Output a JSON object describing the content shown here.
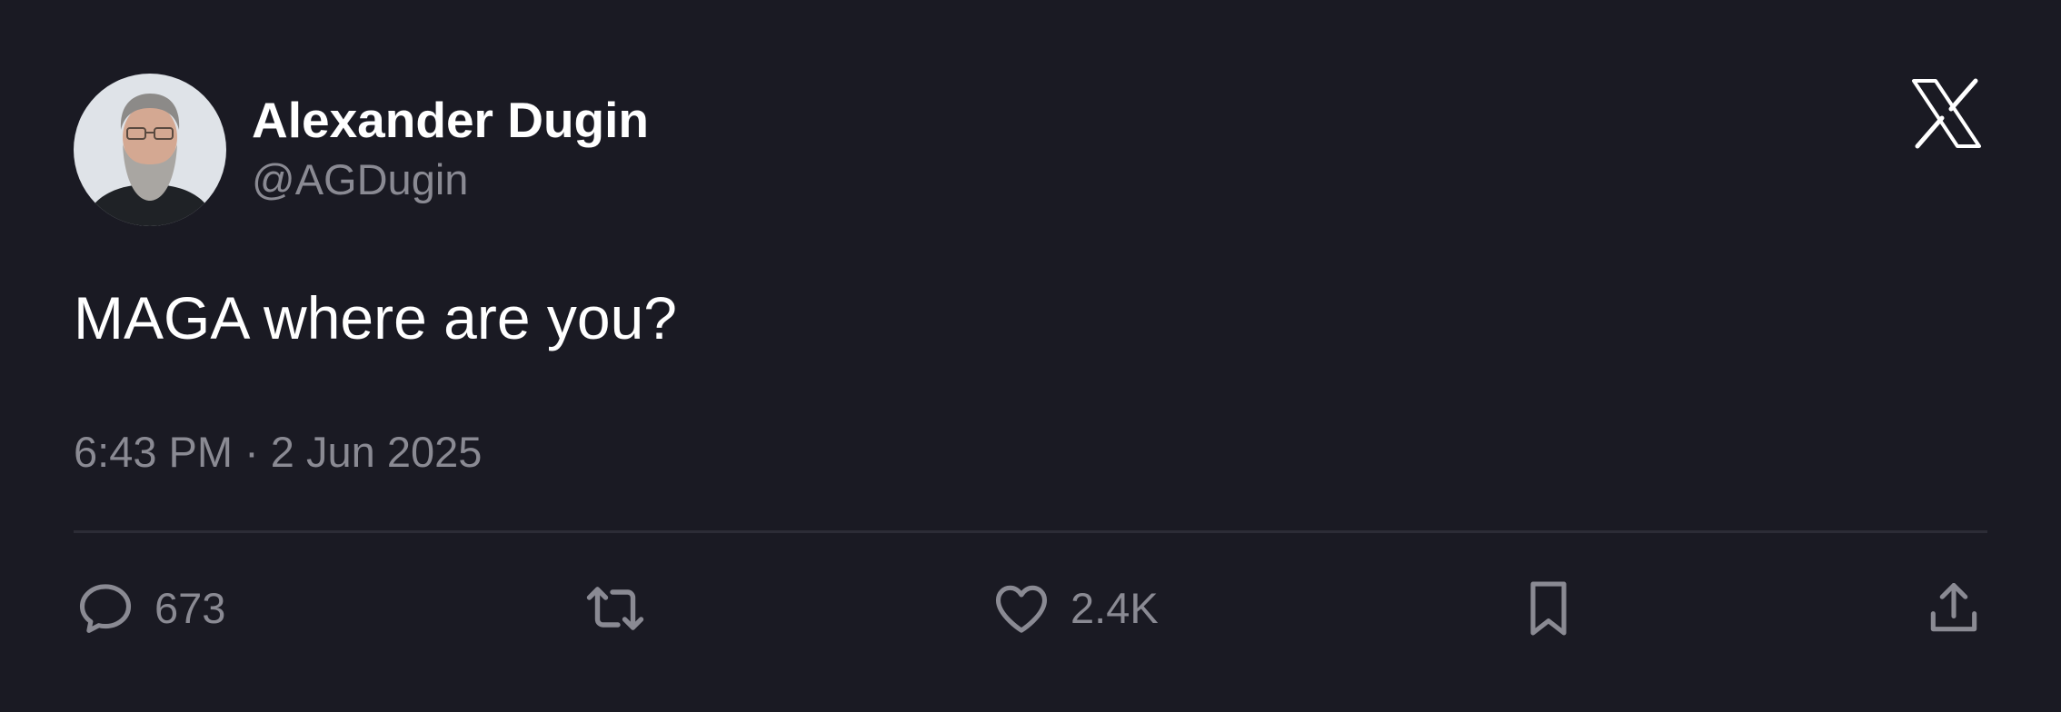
{
  "author": {
    "display_name": "Alexander Dugin",
    "handle": "@AGDugin",
    "avatar_icon": "avatar-photo"
  },
  "brand": {
    "logo_icon": "x-logo-icon"
  },
  "tweet": {
    "text": "MAGA where are you?",
    "timestamp": "6:43 PM · 2 Jun 2025"
  },
  "actions": {
    "reply": {
      "icon": "reply-icon",
      "count": "673"
    },
    "retweet": {
      "icon": "retweet-icon"
    },
    "like": {
      "icon": "heart-icon",
      "count": "2.4K"
    },
    "bookmark": {
      "icon": "bookmark-icon"
    },
    "share": {
      "icon": "share-icon"
    }
  },
  "colors": {
    "background": "#1a1a23",
    "primary_text": "#ffffff",
    "secondary_text": "#8a8a93",
    "divider": "#2c2c36"
  }
}
